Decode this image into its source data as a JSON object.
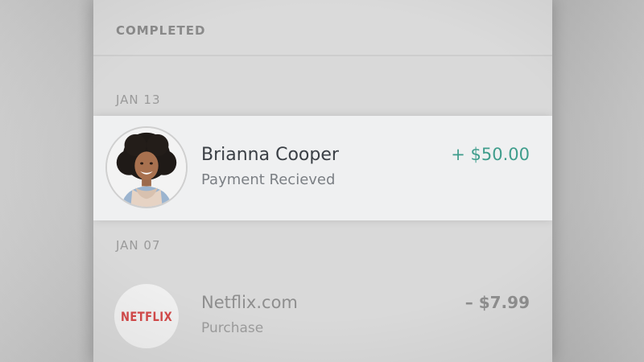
{
  "section": {
    "title": "COMPLETED"
  },
  "groups": [
    {
      "date": "JAN 13",
      "transaction": {
        "name": "Brianna Cooper",
        "description": "Payment Recieved",
        "amount": "+ $50.00",
        "avatar_icon": "person-avatar-icon",
        "amount_color": "#3f9d8c"
      }
    },
    {
      "date": "JAN 07",
      "transaction": {
        "name": "Netflix.com",
        "description": "Purchase",
        "amount": "– $7.99",
        "logo_text": "NETFLIX",
        "logo_color": "#d34a4a"
      }
    }
  ]
}
